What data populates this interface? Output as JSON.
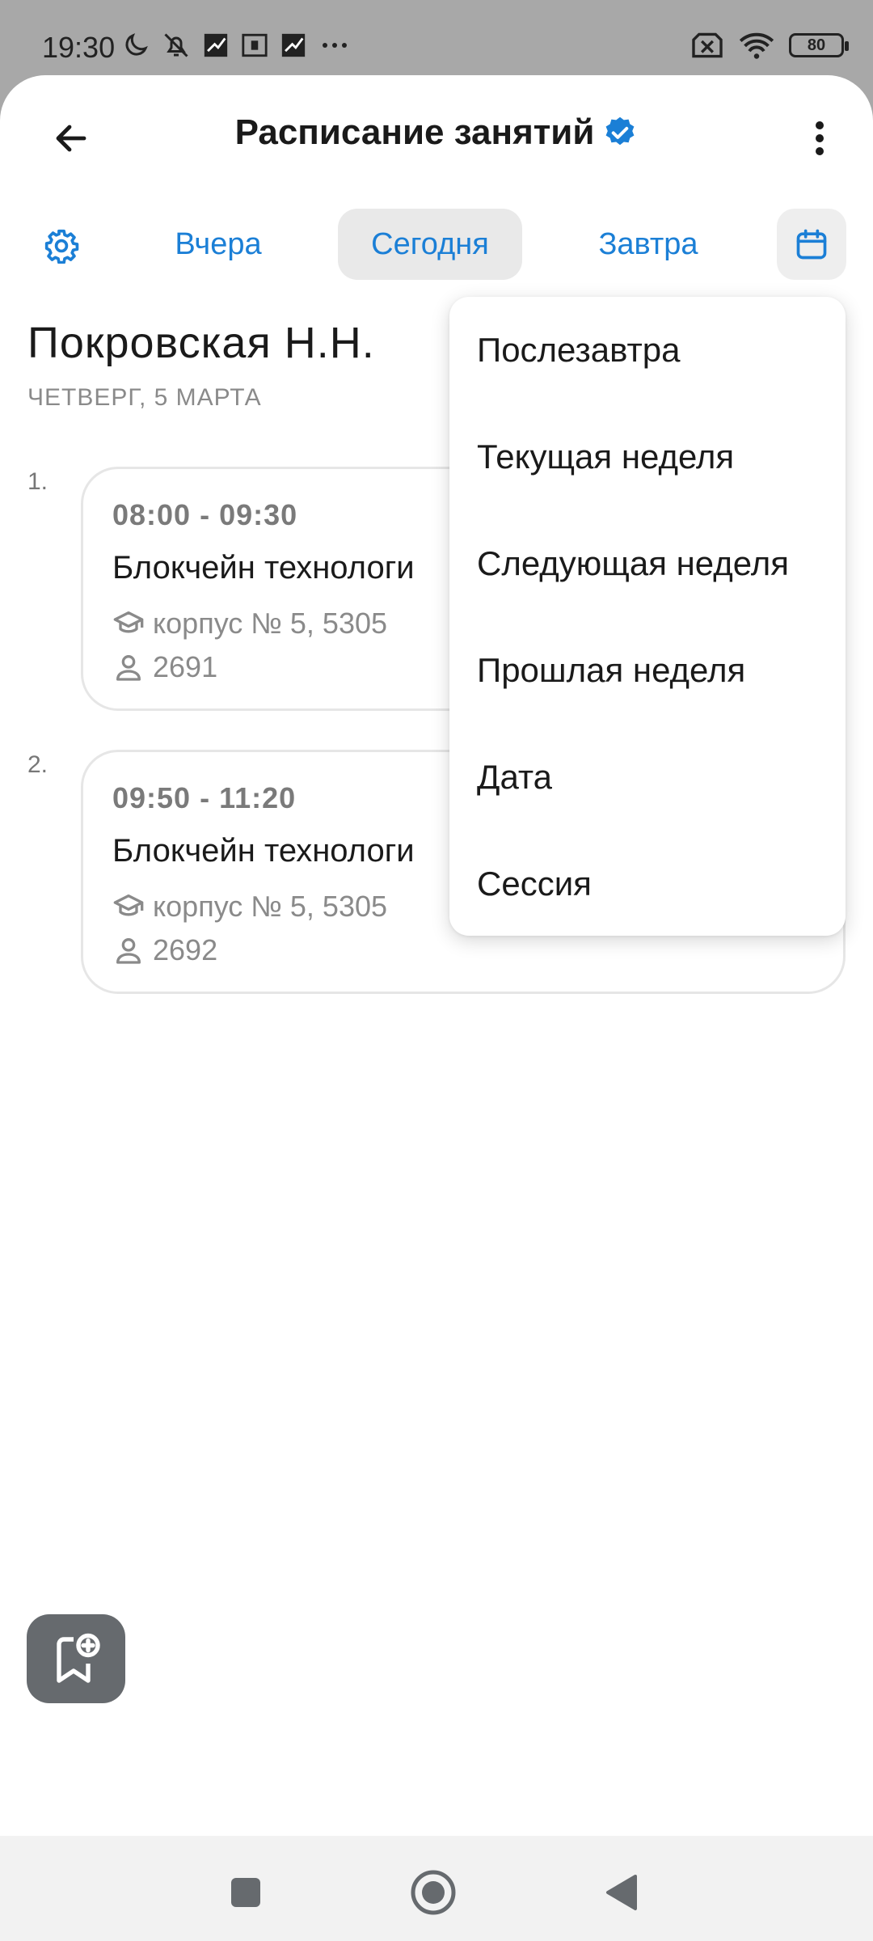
{
  "status_bar": {
    "time": "19:30",
    "battery": "80",
    "icons_left": [
      "moon-icon",
      "muted-bell-icon",
      "notification-icon",
      "sim-icon",
      "notification-icon",
      "more-dots-icon"
    ],
    "icons_right": [
      "no-sim-icon",
      "wifi-icon",
      "battery-icon"
    ]
  },
  "appbar": {
    "title": "Расписание занятий",
    "verified_icon": "verified-badge-icon"
  },
  "tabs": {
    "yesterday": "Вчера",
    "today": "Сегодня",
    "tomorrow": "Завтра"
  },
  "teacher": {
    "name": "Покровская Н.Н.",
    "day": "ЧЕТВЕРГ, 5 МАРТА"
  },
  "lessons": [
    {
      "number": "1.",
      "time": "08:00 - 09:30",
      "subject": "Блокчейн технологи",
      "place": "корпус № 5, 5305",
      "group": "2691"
    },
    {
      "number": "2.",
      "time": "09:50 - 11:20",
      "subject": "Блокчейн технологи",
      "place": "корпус № 5, 5305",
      "group": "2692"
    }
  ],
  "menu": {
    "items": [
      "Послезавтра",
      "Текущая неделя",
      "Следующая неделя",
      "Прошлая неделя",
      "Дата",
      "Сессия"
    ]
  },
  "colors": {
    "accent": "#1b7fd6",
    "status_bar": "#a8a8a8",
    "fab": "#666a6e"
  }
}
